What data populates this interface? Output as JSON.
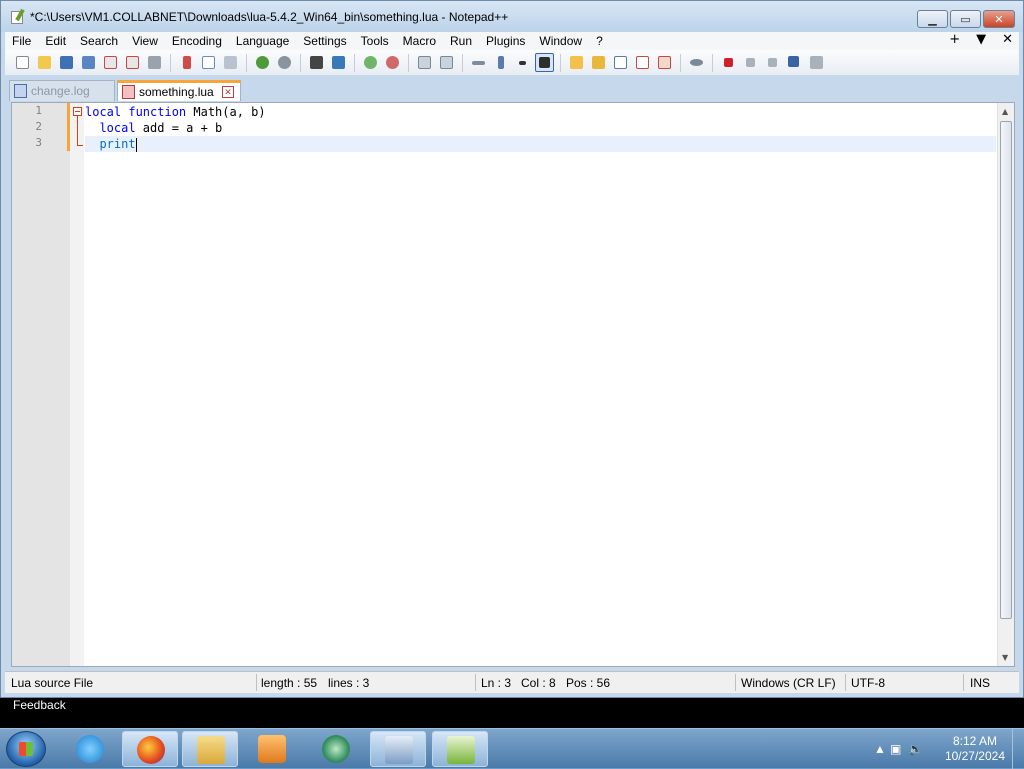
{
  "window": {
    "title": "*C:\\Users\\VM1.COLLABNET\\Downloads\\lua-5.4.2_Win64_bin\\something.lua - Notepad++",
    "minimize": "▁",
    "maximize": "▭",
    "close": "✕"
  },
  "menu": {
    "items": [
      "File",
      "Edit",
      "Search",
      "View",
      "Encoding",
      "Language",
      "Settings",
      "Tools",
      "Macro",
      "Run",
      "Plugins",
      "Window",
      "?"
    ],
    "right": [
      "+",
      "▼",
      "✕"
    ]
  },
  "tabs": [
    {
      "label": "change.log",
      "active": false
    },
    {
      "label": "something.lua",
      "active": true
    }
  ],
  "editor": {
    "line_numbers": [
      "1",
      "2",
      "3"
    ],
    "lines": [
      {
        "indent": "",
        "kw1": "local",
        "kw2": "function",
        "rest": " Math(a, b)"
      },
      {
        "indent": "  ",
        "kw1": "local",
        "rest": " add = a + b"
      },
      {
        "indent": "  ",
        "fn": "print"
      }
    ]
  },
  "status": {
    "file_type": "Lua source File",
    "length": "length : 55",
    "lines": "lines : 3",
    "ln": "Ln : 3",
    "col": "Col : 8",
    "pos": "Pos : 56",
    "eol": "Windows (CR LF)",
    "encoding": "UTF-8",
    "mode": "INS"
  },
  "feedback": "Feedback",
  "taskbar": {
    "time": "8:12 AM",
    "date": "10/27/2024"
  },
  "colors": {
    "keyword": "#0000ff",
    "function": "#0072c6",
    "current_line": "#e8f0fb",
    "tab_accent": "#f7a43b"
  }
}
